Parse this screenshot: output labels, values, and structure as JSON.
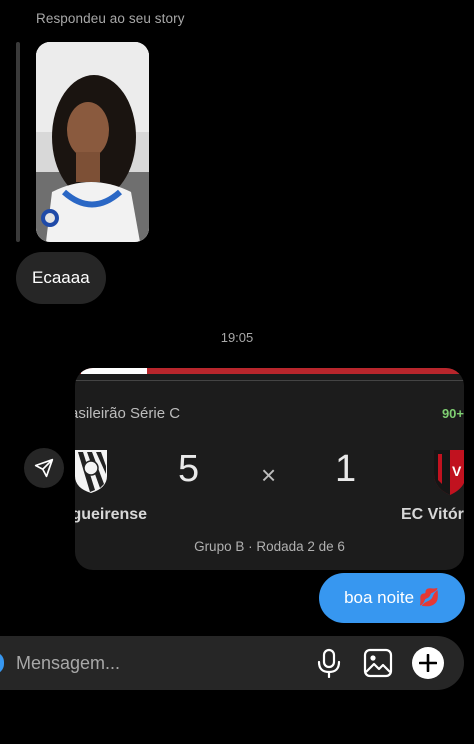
{
  "story_reply": {
    "caption": "Respondeu ao seu story",
    "reply_text": "Ecaaaa"
  },
  "timestamp": "19:05",
  "score_card": {
    "league": "rasileirão Série C",
    "status": "90+",
    "home_team": "igueirense",
    "home_score": "5",
    "separator": "×",
    "away_score": "1",
    "away_team": "EC Vitóri",
    "round_info": "Grupo B · Rodada 2 de 6",
    "progress": 0.17
  },
  "outgoing_message": {
    "text": "boa noite 💋"
  },
  "composer": {
    "placeholder": "Mensagem..."
  },
  "colors": {
    "accent": "#3797f0",
    "bubble_incoming": "#262626",
    "status_green": "#7fcf72",
    "card_bar_red": "#b8262c"
  },
  "icons": {
    "share": "send-icon",
    "mic": "microphone-icon",
    "gallery": "image-icon",
    "add": "plus-circle-icon"
  }
}
